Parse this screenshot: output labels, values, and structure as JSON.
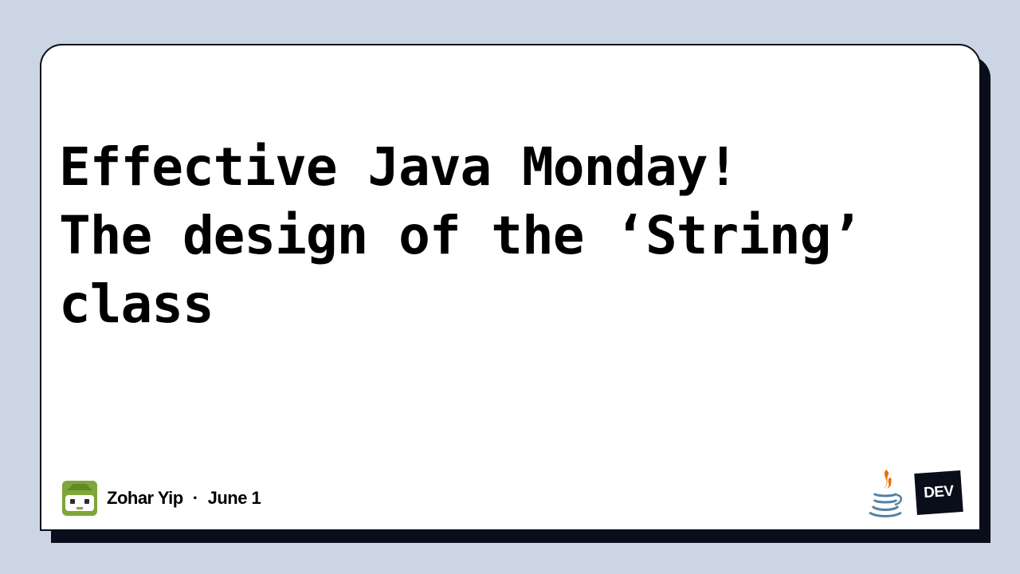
{
  "post": {
    "title_lines": [
      "Effective Java Monday!",
      "The design of the ‘String’",
      "class"
    ],
    "author": "Zohar Yip",
    "separator": "·",
    "date": "June 1"
  },
  "badges": {
    "dev_label": "DEV",
    "java_icon": "java-icon"
  },
  "colors": {
    "background": "#cbd5e3",
    "card": "#ffffff",
    "shadow": "#0a0e1a",
    "avatar": "#7ea63a"
  }
}
